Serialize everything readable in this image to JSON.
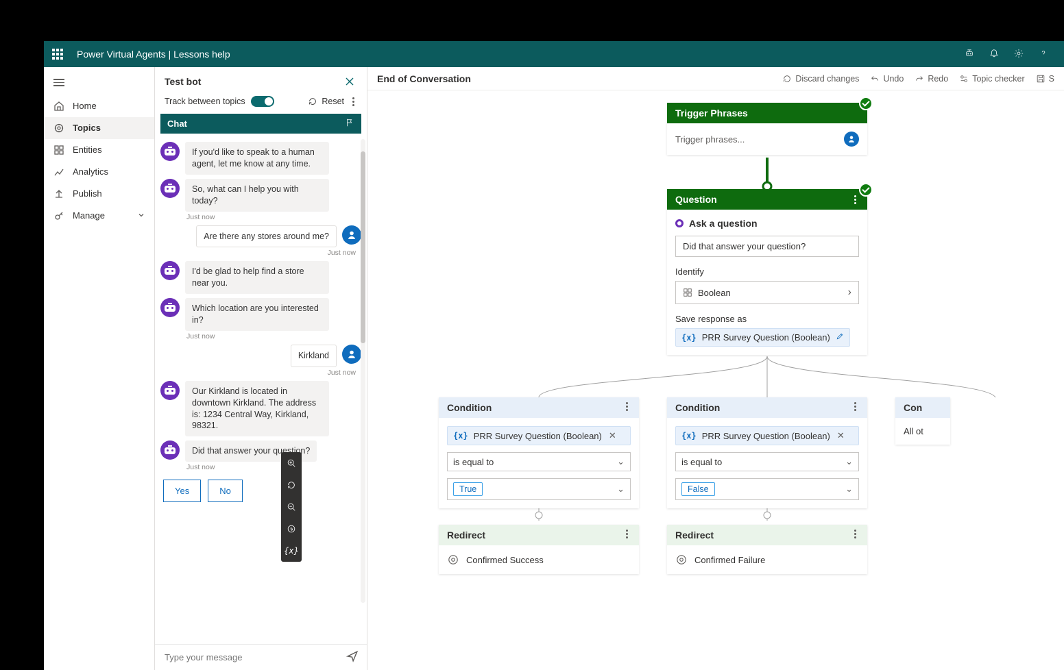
{
  "titlebar": {
    "title": "Power Virtual Agents | Lessons help"
  },
  "nav": {
    "home": "Home",
    "topics": "Topics",
    "entities": "Entities",
    "analytics": "Analytics",
    "publish": "Publish",
    "manage": "Manage"
  },
  "testbot": {
    "title": "Test bot",
    "track_label": "Track between topics",
    "reset": "Reset",
    "chat_tab": "Chat",
    "messages": {
      "m1": "If you'd like to speak to a human agent, let me know at any time.",
      "m2": "So, what can I help you with today?",
      "ts1": "Just now",
      "u1": "Are there any stores around me?",
      "tsu1": "Just now",
      "m3": "I'd be glad to help find a store near you.",
      "m4": "Which location are you interested in?",
      "ts2": "Just now",
      "u2": "Kirkland",
      "tsu2": "Just now",
      "m5": "Our Kirkland is located in downtown Kirkland. The address is: 1234 Central Way, Kirkland, 98321.",
      "m6": "Did that answer your question?",
      "ts3": "Just now"
    },
    "choices": {
      "yes": "Yes",
      "no": "No"
    },
    "composer_placeholder": "Type your message"
  },
  "canvas": {
    "title": "End of Conversation",
    "tools": {
      "discard": "Discard changes",
      "undo": "Undo",
      "redo": "Redo",
      "checker": "Topic checker",
      "save": "S"
    },
    "trigger": {
      "header": "Trigger Phrases",
      "placeholder": "Trigger phrases..."
    },
    "question": {
      "header": "Question",
      "ask_label": "Ask a question",
      "prompt": "Did that answer your question?",
      "identify_label": "Identify",
      "identify_value": "Boolean",
      "save_label": "Save response as",
      "var_name": "PRR Survey Question",
      "var_type": "(Boolean)"
    },
    "cond1": {
      "header": "Condition",
      "var": "PRR Survey Question",
      "vartype": "(Boolean)",
      "op": "is equal to",
      "val": "True"
    },
    "cond2": {
      "header": "Condition",
      "var": "PRR Survey Question",
      "vartype": "(Boolean)",
      "op": "is equal to",
      "val": "False"
    },
    "cond3": {
      "header": "Con",
      "body": "All ot"
    },
    "redirect1": {
      "header": "Redirect",
      "target": "Confirmed Success"
    },
    "redirect2": {
      "header": "Redirect",
      "target": "Confirmed Failure"
    }
  }
}
